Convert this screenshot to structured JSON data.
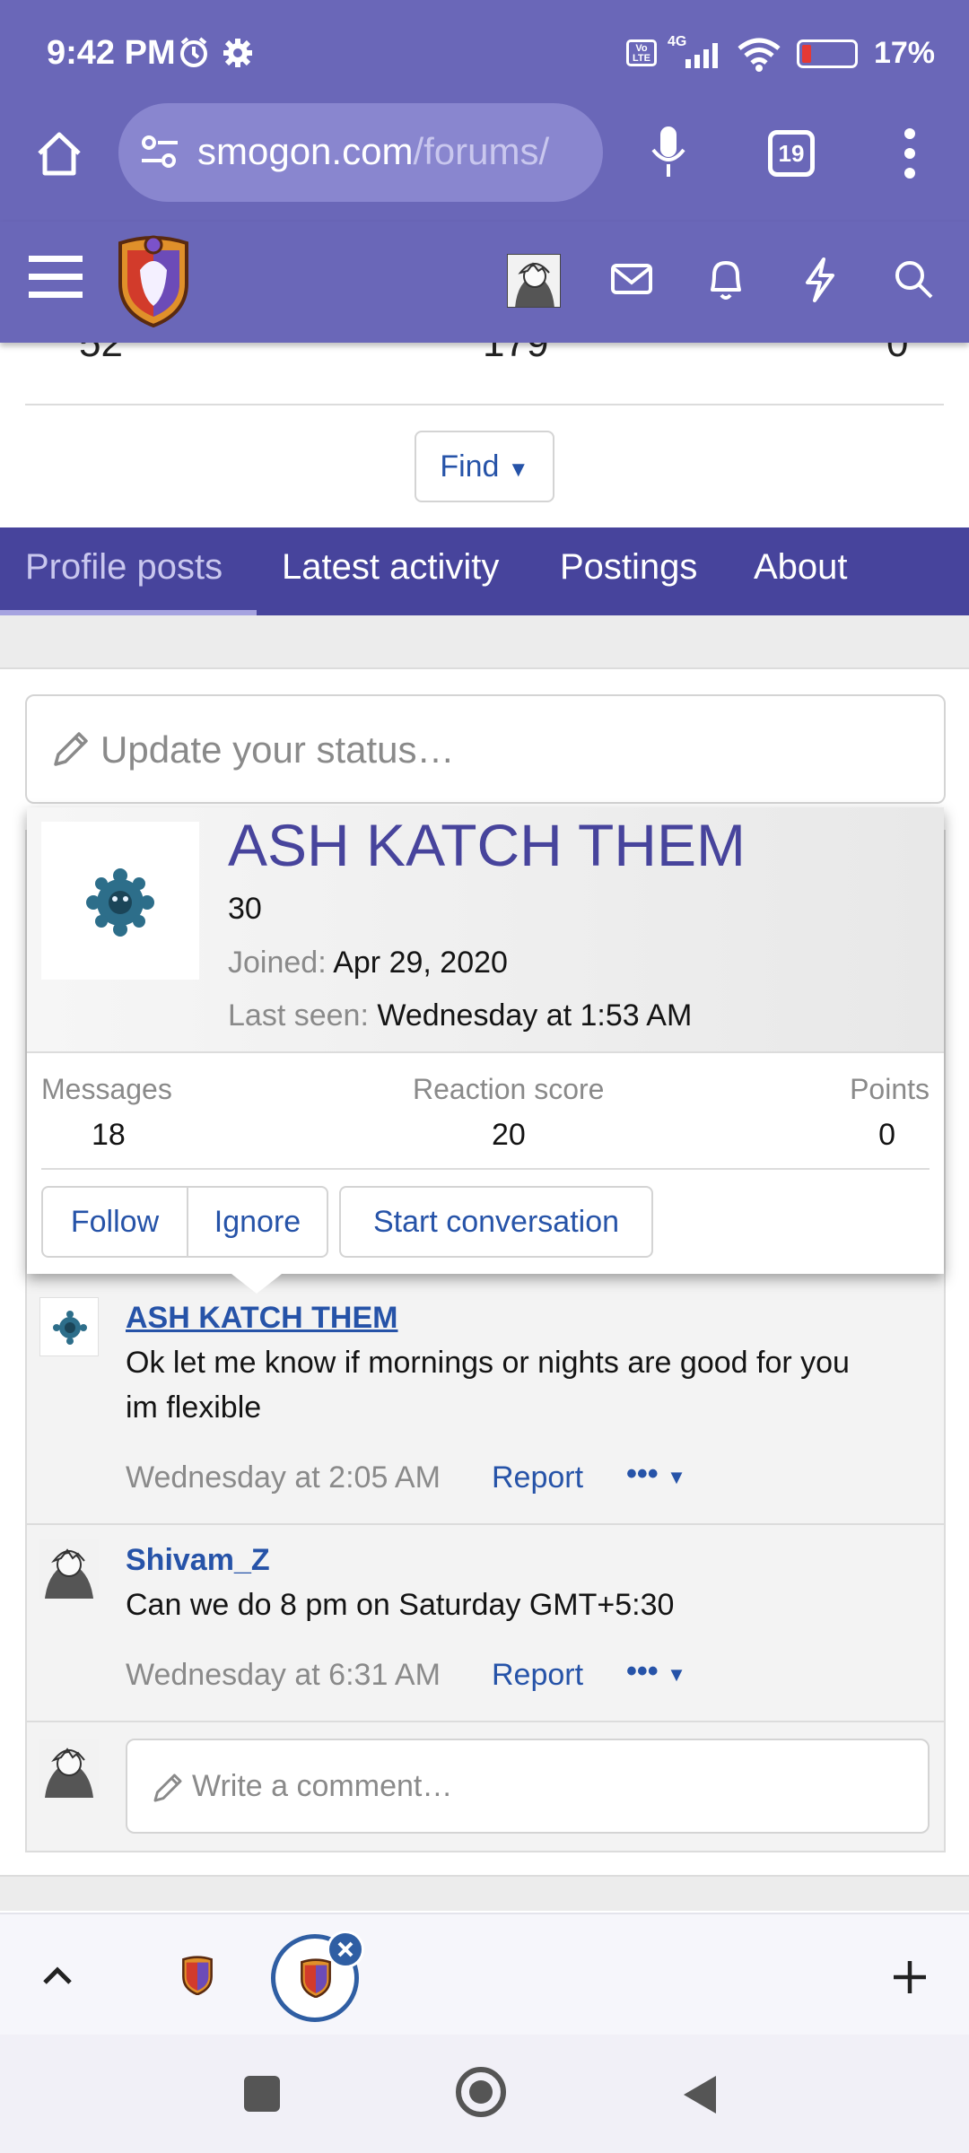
{
  "status_bar": {
    "time": "9:42 PM",
    "network": "4G",
    "volte": "Vo LTE",
    "battery_pct": "17%",
    "battery_level": 0.17
  },
  "browser": {
    "url_main": "smogon.com",
    "url_path": "/forums/",
    "tab_count": "19"
  },
  "stats_row": {
    "values": [
      "52",
      "179",
      "0"
    ]
  },
  "find_button": "Find",
  "tabs": [
    {
      "label": "Profile posts",
      "active": true
    },
    {
      "label": "Latest activity",
      "active": false
    },
    {
      "label": "Postings",
      "active": false
    },
    {
      "label": "About",
      "active": false
    }
  ],
  "status_input": {
    "placeholder": "Update your status…"
  },
  "popup": {
    "username": "ASH KATCH THEM",
    "user_title": "30",
    "joined_label": "Joined:",
    "joined_value": "Apr 29, 2020",
    "last_seen_label": "Last seen:",
    "last_seen_value": "Wednesday at 1:53 AM",
    "stats": [
      {
        "label": "Messages",
        "value": "18"
      },
      {
        "label": "Reaction score",
        "value": "20"
      },
      {
        "label": "Points",
        "value": "0"
      }
    ],
    "buttons": {
      "follow": "Follow",
      "ignore": "Ignore",
      "start_conversation": "Start conversation"
    }
  },
  "posts": [
    {
      "author": "ASH KATCH THEM",
      "message_line1": "Ok let me know if mornings or nights are good for you",
      "message_line2": "im flexible",
      "timestamp": "Wednesday at 2:05 AM",
      "report": "Report",
      "more": "•••"
    },
    {
      "author": "Shivam_Z",
      "message_line1": "Can we do 8 pm on Saturday GMT+5:30",
      "timestamp": "Wednesday at 6:31 AM",
      "report": "Report",
      "more": "•••"
    }
  ],
  "comment_box": {
    "placeholder": "Write a comment…"
  },
  "colors": {
    "header_purple": "#6a67b8",
    "tab_bar": "#47449c",
    "link_blue": "#2653a8",
    "username": "#47449c"
  }
}
